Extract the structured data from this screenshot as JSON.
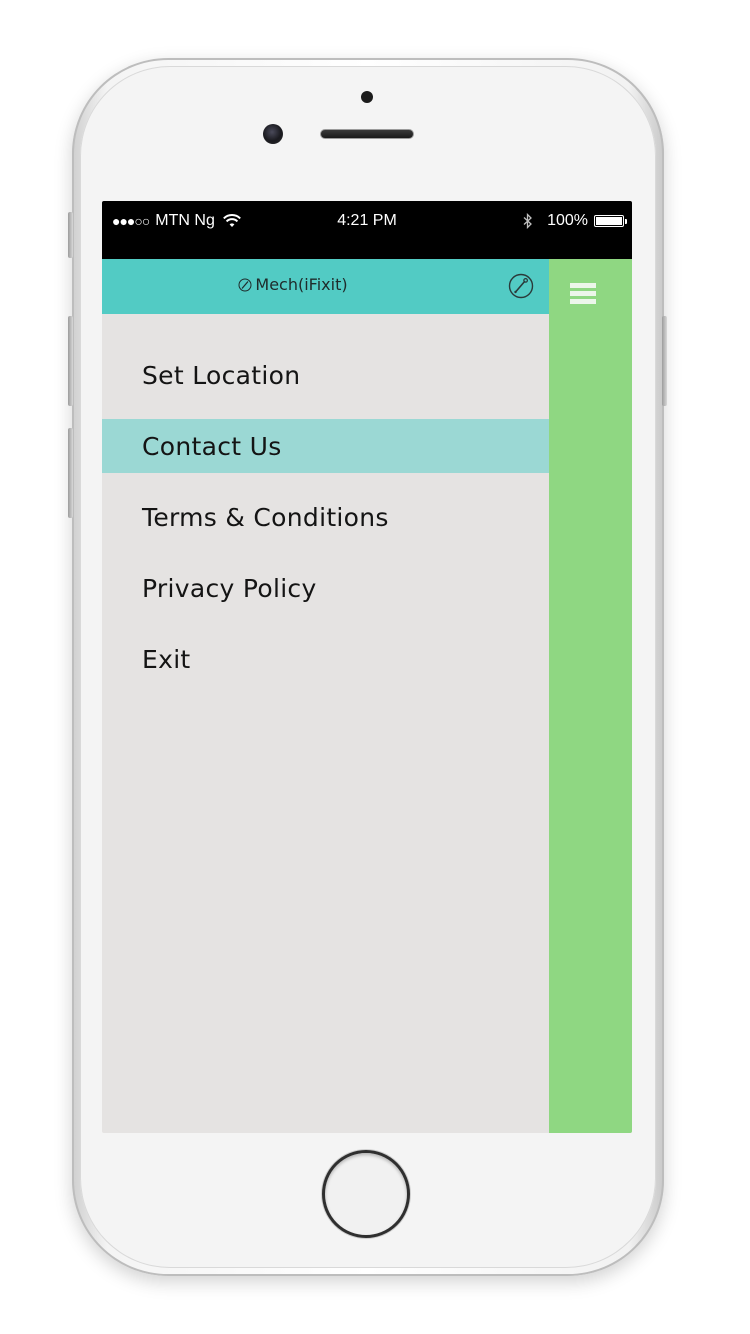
{
  "status_bar": {
    "signal_dots": "●●●○○",
    "carrier": "MTN Ng",
    "time": "4:21 PM",
    "battery_percent": "100%",
    "battery_level": 1.0,
    "wifi_icon": "wifi-icon",
    "bluetooth_icon": "bluetooth-icon"
  },
  "header": {
    "title": "Mech(iFixit)",
    "logo_icon": "wrench-icon",
    "tool_icon": "wrench-circle-icon",
    "color": "#52cbc4"
  },
  "menu": {
    "items": [
      {
        "label": "Set Location",
        "active": false
      },
      {
        "label": "Contact Us",
        "active": true
      },
      {
        "label": "Terms & Conditions",
        "active": false
      },
      {
        "label": "Privacy Policy",
        "active": false
      },
      {
        "label": "Exit",
        "active": false
      }
    ],
    "active_color": "#9bd8d4",
    "background": "#e5e3e2"
  },
  "right_pane": {
    "menu_icon": "hamburger-icon",
    "color": "#8fd782"
  }
}
